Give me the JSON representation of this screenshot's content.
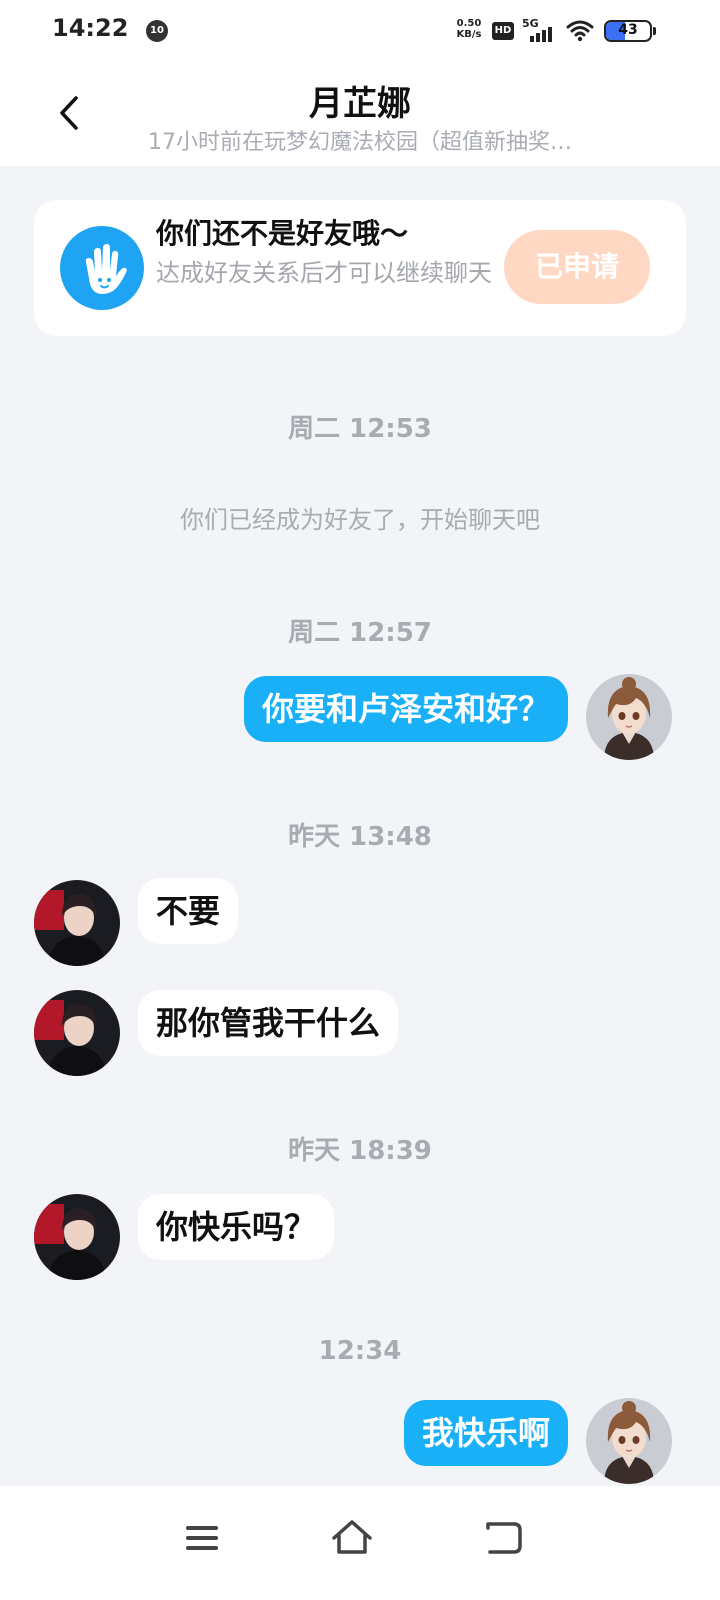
{
  "status_bar": {
    "time": "14:22",
    "notification_badge": "10",
    "net_speed_value": "0.50",
    "net_speed_unit": "KB/s",
    "hd_label": "HD",
    "network_label": "5G",
    "battery": "43",
    "battery_level": 0.43
  },
  "header": {
    "title": "月芷娜",
    "subtitle": "17小时前在玩梦幻魔法校园（超值新抽奖…"
  },
  "banner": {
    "title": "你们还不是好友哦～",
    "description": "达成好友关系后才可以继续聊天",
    "button_label": "已申请",
    "icon": "waving-hand-icon"
  },
  "messages": {
    "ts1": "周二 12:53",
    "system": "你们已经成为好友了，开始聊天吧",
    "ts2": "周二 12:57",
    "out1": "你要和卢泽安和好？",
    "ts3": "昨天 13:48",
    "in1": "不要",
    "in2": "那你管我干什么",
    "ts4": "昨天 18:39",
    "in3": "你快乐吗？",
    "ts5": "12:34",
    "out2": "我快乐啊"
  },
  "colors": {
    "accent": "#1ab0f7",
    "applied_button": "#ffd8c4",
    "background": "#f3f4f8",
    "muted_text": "#a8abb2"
  },
  "nav_bar": {
    "menu": "menu-icon",
    "home": "home-icon",
    "back": "back-icon"
  }
}
